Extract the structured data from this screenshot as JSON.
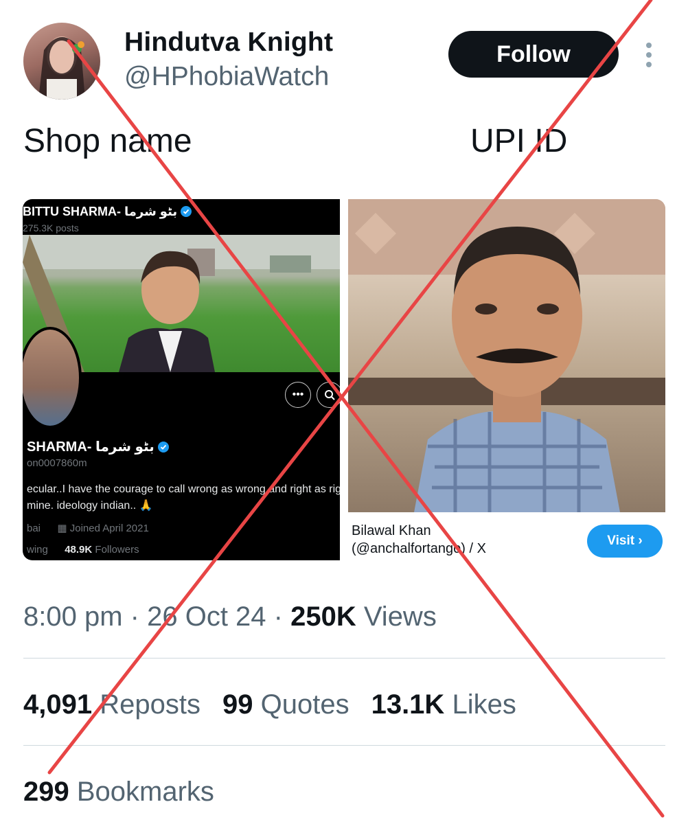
{
  "header": {
    "name": "Hindutva Knight",
    "handle": "@HPhobiaWatch",
    "follow_label": "Follow"
  },
  "tweet": {
    "text_left": "Shop name",
    "text_right": "UPI ID"
  },
  "profile_screenshot": {
    "name_top": "BITTU SHARMA- بٹو شرما",
    "posts": "275.3K posts",
    "name": "SHARMA- بٹو شرما",
    "handle": "on0007860m",
    "bio_line1": "ecular..I have the courage to call wrong as wrong and right as right.",
    "bio_line2": "mine.  ideology indian.. 🙏",
    "location": "bai",
    "joined": "Joined April 2021",
    "following_label": "wing",
    "followers_count": "48.9K",
    "followers_label": "Followers"
  },
  "link_card": {
    "title_line1": "Bilawal Khan",
    "title_line2": "(@anchalfortango) / X",
    "visit_label": "Visit ›"
  },
  "meta": {
    "time": "8:00 pm",
    "date": "26 Oct 24",
    "views_count": "250K",
    "views_label": "Views"
  },
  "stats": {
    "reposts_count": "4,091",
    "reposts_label": "Reposts",
    "quotes_count": "99",
    "quotes_label": "Quotes",
    "likes_count": "13.1K",
    "likes_label": "Likes",
    "bookmarks_count": "299",
    "bookmarks_label": "Bookmarks"
  },
  "colors": {
    "overlay_x": "#e84545",
    "visit_button": "#1d9bf0",
    "verified_badge": "#1d9bf0"
  }
}
